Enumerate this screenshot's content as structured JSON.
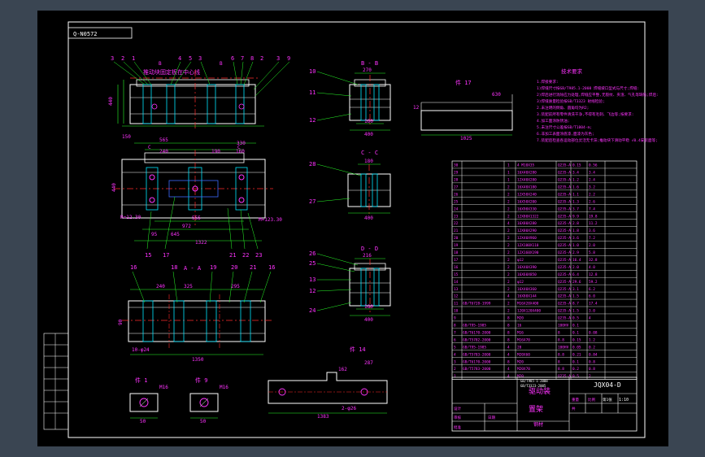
{
  "sheet": {
    "code_box": "Q-N0572",
    "title_note": "推动块固定板在中心线"
  },
  "views": {
    "bb": "B - B",
    "cc": "C - C",
    "dd": "D - D",
    "aa": "A - A",
    "part17": "件 17",
    "part14": "件 14",
    "part1": "件 1",
    "part9": "件 9"
  },
  "dims": {
    "main_top": [
      "565",
      "240",
      "330",
      "190",
      "160"
    ],
    "main_height": "440",
    "main_width_a": "555",
    "main_width_b": "972",
    "main_width_c": "1322",
    "main_645": "645",
    "main_150": "150",
    "main_95": "95",
    "m_side": "M=123.30",
    "k_side": "R=12.30",
    "dd_216": "216",
    "dd_160": "160",
    "dd_400": "400",
    "bb_270": "270",
    "bb_160": "160",
    "bb_400": "400",
    "cc_180": "180",
    "cc_400": "400",
    "aa_240": "240",
    "aa_325": "325",
    "aa_295": "295",
    "aa_1350": "1350",
    "aa_90": "90",
    "p17_1025": "1025",
    "p17_630": "630",
    "p17_12": "12",
    "p14_287": "287",
    "p14_1383": "1383",
    "p14_162": "162",
    "p14_phi": "2-φ26",
    "p1_m16": "M16",
    "p1_50": "50",
    "p9_m16": "M16",
    "p9_50": "50"
  },
  "callouts": {
    "top_left": [
      "3",
      "2",
      "1"
    ],
    "top_mid": [
      "4",
      "5",
      "3"
    ],
    "top_right": [
      "6",
      "7",
      "8",
      "2",
      "3",
      "9"
    ],
    "bb": [
      "10",
      "11",
      "12"
    ],
    "cc": [
      "28",
      "27"
    ],
    "dd": [
      "26",
      "25",
      "13",
      "12",
      "24"
    ],
    "mid_left": [
      "15",
      "17"
    ],
    "mid_right": [
      "21",
      "22",
      "23"
    ],
    "aa_top": [
      "16",
      "18",
      "19",
      "20",
      "21",
      "16"
    ],
    "aa_left": "10-φ24",
    "b_mark": "B",
    "c_mark": "C",
    "d_mark": "D",
    "a_mark": "A"
  },
  "notes": {
    "heading": "技术要求",
    "lines": [
      "1.焊接要求:",
      "1)焊缝尺寸按GB/T985.1-2008 焊缝坡口型式与尺寸;焊缝:",
      "2)焊后进行消除应力处理,焊缝应平整,无裂纹、夹渣、气孔等缺陷;焊后:",
      "3)焊缝质量检验按GB/T3323 射线检验;",
      "2.未注明的倒角、圆角均为R2;",
      "3.装配前所有零件清洗干净,不得有毛刺、飞边等;按要求:",
      "4.加工面涂防锈油;",
      "5.未注尺寸公差按GB/T1804-m;",
      "6.非加工表面涂底漆,面漆为灰色;",
      "7.装配后检查各运动部位灵活无卡滞;推动块下滑动平稳 √0.4安装面等;"
    ]
  },
  "bom": {
    "rows": [
      {
        "no": "30",
        "code": "",
        "name": "4 M10X35",
        "qty": "1",
        "mat": "Q235-A",
        "w1": "0.15",
        "w2": "0.56"
      },
      {
        "no": "29",
        "code": "",
        "name": "16X40X280",
        "qty": "1",
        "mat": "Q235-A",
        "w1": "3.4",
        "w2": "3.4"
      },
      {
        "no": "28",
        "code": "",
        "name": "12X40X280",
        "qty": "1",
        "mat": "Q235-A",
        "w1": "1.2",
        "w2": "2.4"
      },
      {
        "no": "27",
        "code": "",
        "name": "16X40X180",
        "qty": "2",
        "mat": "Q235-A",
        "w1": "1.6",
        "w2": "3.2"
      },
      {
        "no": "26",
        "code": "",
        "name": "12X50X240",
        "qty": "2",
        "mat": "Q235-A",
        "w1": "1.1",
        "w2": "2.2"
      },
      {
        "no": "25",
        "code": "",
        "name": "16X50X200",
        "qty": "2",
        "mat": "Q235-A",
        "w1": "1.3",
        "w2": "2.6"
      },
      {
        "no": "24",
        "code": "",
        "name": "16X90X330",
        "qty": "2",
        "mat": "Q235-A",
        "w1": "3.7",
        "w2": "7.4"
      },
      {
        "no": "23",
        "code": "",
        "name": "12X80X1322",
        "qty": "2",
        "mat": "Q235-A",
        "w1": "9.9",
        "w2": "19.8"
      },
      {
        "no": "22",
        "code": "",
        "name": "16X80X280",
        "qty": "4",
        "mat": "Q235-A",
        "w1": "2.8",
        "w2": "11.2"
      },
      {
        "no": "21",
        "code": "",
        "name": "12X80X290",
        "qty": "2",
        "mat": "Q235-A",
        "w1": "1.8",
        "w2": "3.6"
      },
      {
        "no": "20",
        "code": "",
        "name": "12X40X960",
        "qty": "2",
        "mat": "Q235-A",
        "w1": "3.6",
        "w2": "7.2"
      },
      {
        "no": "19",
        "code": "",
        "name": "12X100X110",
        "qty": "2",
        "mat": "Q235-A",
        "w1": "1.0",
        "w2": "2.0"
      },
      {
        "no": "18",
        "code": "",
        "name": "12X160X190",
        "qty": "2",
        "mat": "Q235-A",
        "w1": "2.9",
        "w2": "5.8"
      },
      {
        "no": "17",
        "code": "",
        "name": "φ12",
        "qty": "2",
        "mat": "Q235-A",
        "w1": "16.4",
        "w2": "32.8"
      },
      {
        "no": "16",
        "code": "",
        "name": "16X40X390",
        "qty": "2",
        "mat": "Q235-A",
        "w1": "2.0",
        "w2": "4.0"
      },
      {
        "no": "15",
        "code": "",
        "name": "16X60X850",
        "qty": "2",
        "mat": "Q235-A",
        "w1": "6.4",
        "w2": "12.8"
      },
      {
        "no": "14",
        "code": "",
        "name": "φ12",
        "qty": "2",
        "mat": "Q235-A",
        "w1": "29.6",
        "w2": "59.2"
      },
      {
        "no": "13",
        "code": "",
        "name": "16X40X360",
        "qty": "2",
        "mat": "Q235-A",
        "w1": "3.1",
        "w2": "6.2"
      },
      {
        "no": "12",
        "code": "",
        "name": "16X80X144",
        "qty": "4",
        "mat": "Q235-A",
        "w1": "1.5",
        "w2": "6.0"
      },
      {
        "no": "11",
        "code": "GB/T6728-1999",
        "name": "M16X20X400",
        "qty": "2",
        "mat": "Q235-A",
        "w1": "8.7",
        "w2": "17.4"
      },
      {
        "no": "10",
        "code": "",
        "name": "120X120X400",
        "qty": "2",
        "mat": "Q235-A",
        "w1": "1.5",
        "w2": "3.0"
      },
      {
        "no": "9",
        "code": "",
        "name": "M20",
        "qty": "8",
        "mat": "Q235-A",
        "w1": "0.5",
        "w2": "4"
      },
      {
        "no": "8",
        "code": "GB/T95-1985",
        "name": "16",
        "qty": "8",
        "mat": "100HV",
        "w1": "0.1",
        "w2": ""
      },
      {
        "no": "7",
        "code": "GB/T6170-2000",
        "name": "M16",
        "qty": "8",
        "mat": "8",
        "w1": "0.1",
        "w2": "0.08"
      },
      {
        "no": "6",
        "code": "GB/T5782-2000",
        "name": "M16X70",
        "qty": "8",
        "mat": "8.8",
        "w1": "0.15",
        "w2": "1.2"
      },
      {
        "no": "5",
        "code": "GB/T95-1985",
        "name": "20",
        "qty": "4",
        "mat": "100HV",
        "w1": "0.05",
        "w2": "0.2"
      },
      {
        "no": "4",
        "code": "GB/T5783-2000",
        "name": "M20X60",
        "qty": "4",
        "mat": "8.8",
        "w1": "0.21",
        "w2": "0.84"
      },
      {
        "no": "3",
        "code": "GB/T6170-2000",
        "name": "M20",
        "qty": "8",
        "mat": "8",
        "w1": "0.1",
        "w2": "0.8"
      },
      {
        "no": "2",
        "code": "GB/T5783-2000",
        "name": "M20X70",
        "qty": "4",
        "mat": "8.8",
        "w1": "0.2",
        "w2": "0.8"
      },
      {
        "no": "1",
        "code": "",
        "name": "M20",
        "qty": "4",
        "mat": "Q235-A",
        "w1": "0.5",
        "w2": "2"
      }
    ]
  },
  "titleblock": {
    "drawing_no": "JQX04-D",
    "name_line1": "驱动装",
    "name_line2": "置架",
    "ref1": "GB/T985-1-2008",
    "ref2": "GB/T3323-2005",
    "material": "钢材",
    "scale": "1:10",
    "sheet": "第1张",
    "lbl_design": "设计",
    "lbl_check": "审核",
    "lbl_approve": "批准",
    "lbl_weight": "重量",
    "lbl_scale": "比例",
    "lbl_total": "共",
    "lbl_date": "日期"
  },
  "colors": {
    "bg": "#3a4552",
    "sheet": "#000000",
    "white": "#ffffff",
    "cyan": "#00e5ff",
    "green": "#29ff29",
    "magenta": "#ff33ff",
    "red": "#ff2a2a",
    "yellow": "#ffff33",
    "blue": "#3b6bff"
  }
}
